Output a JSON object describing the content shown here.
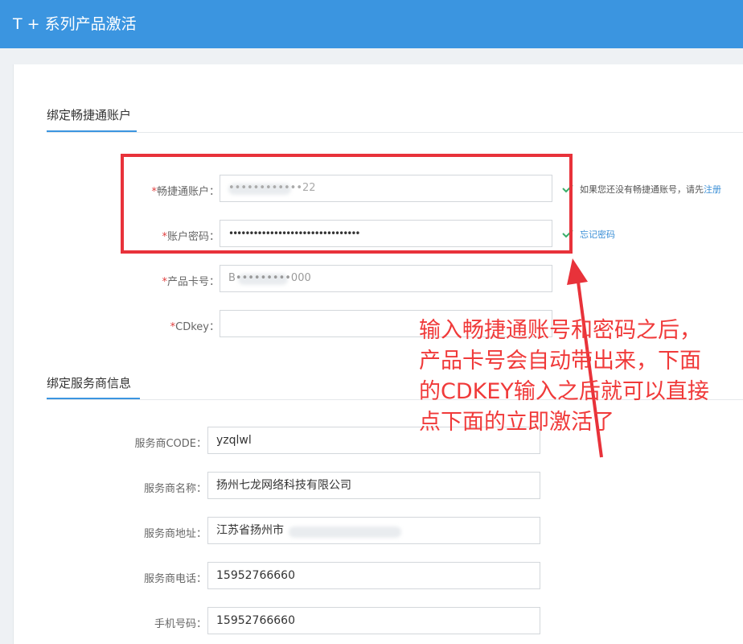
{
  "app": {
    "title": "T + 系列产品激活"
  },
  "section1": {
    "title": "绑定畅捷通账户",
    "fields": {
      "account": {
        "label": "畅捷通账户：",
        "value": "••••••••••••22"
      },
      "password": {
        "label": "账户密码：",
        "value": "••••••••••••••••••••••••••••••••"
      },
      "card": {
        "label": "产品卡号：",
        "value": "B•••••••••000"
      },
      "cdkey": {
        "label": "CDkey：",
        "value": ""
      }
    },
    "account_hint": "如果您还没有畅捷通账号，请先",
    "register_link": "注册",
    "forgot_password_link": "忘记密码",
    "required_mark": "*"
  },
  "section2": {
    "title": "绑定服务商信息",
    "fields": {
      "code": {
        "label": "服务商CODE：",
        "value": "yzqlwl"
      },
      "name": {
        "label": "服务商名称：",
        "value": "扬州七龙网络科技有限公司"
      },
      "address": {
        "label": "服务商地址：",
        "value": "江苏省扬州市"
      },
      "phone": {
        "label": "服务商电话：",
        "value": "15952766660"
      },
      "mobile": {
        "label": "手机号码：",
        "value": "15952766660"
      }
    }
  },
  "annotation": {
    "text": "输入畅捷通账号和密码之后，\n产品卡号会自动带出来，下面\n的CDKEY输入之后就可以直接\n点下面的立即激活了"
  },
  "colors": {
    "header": "#3b95e0",
    "accent": "#3b95e0",
    "required": "#e03e3e",
    "check": "#3aae6a",
    "annotation_red": "#f03a3a"
  }
}
